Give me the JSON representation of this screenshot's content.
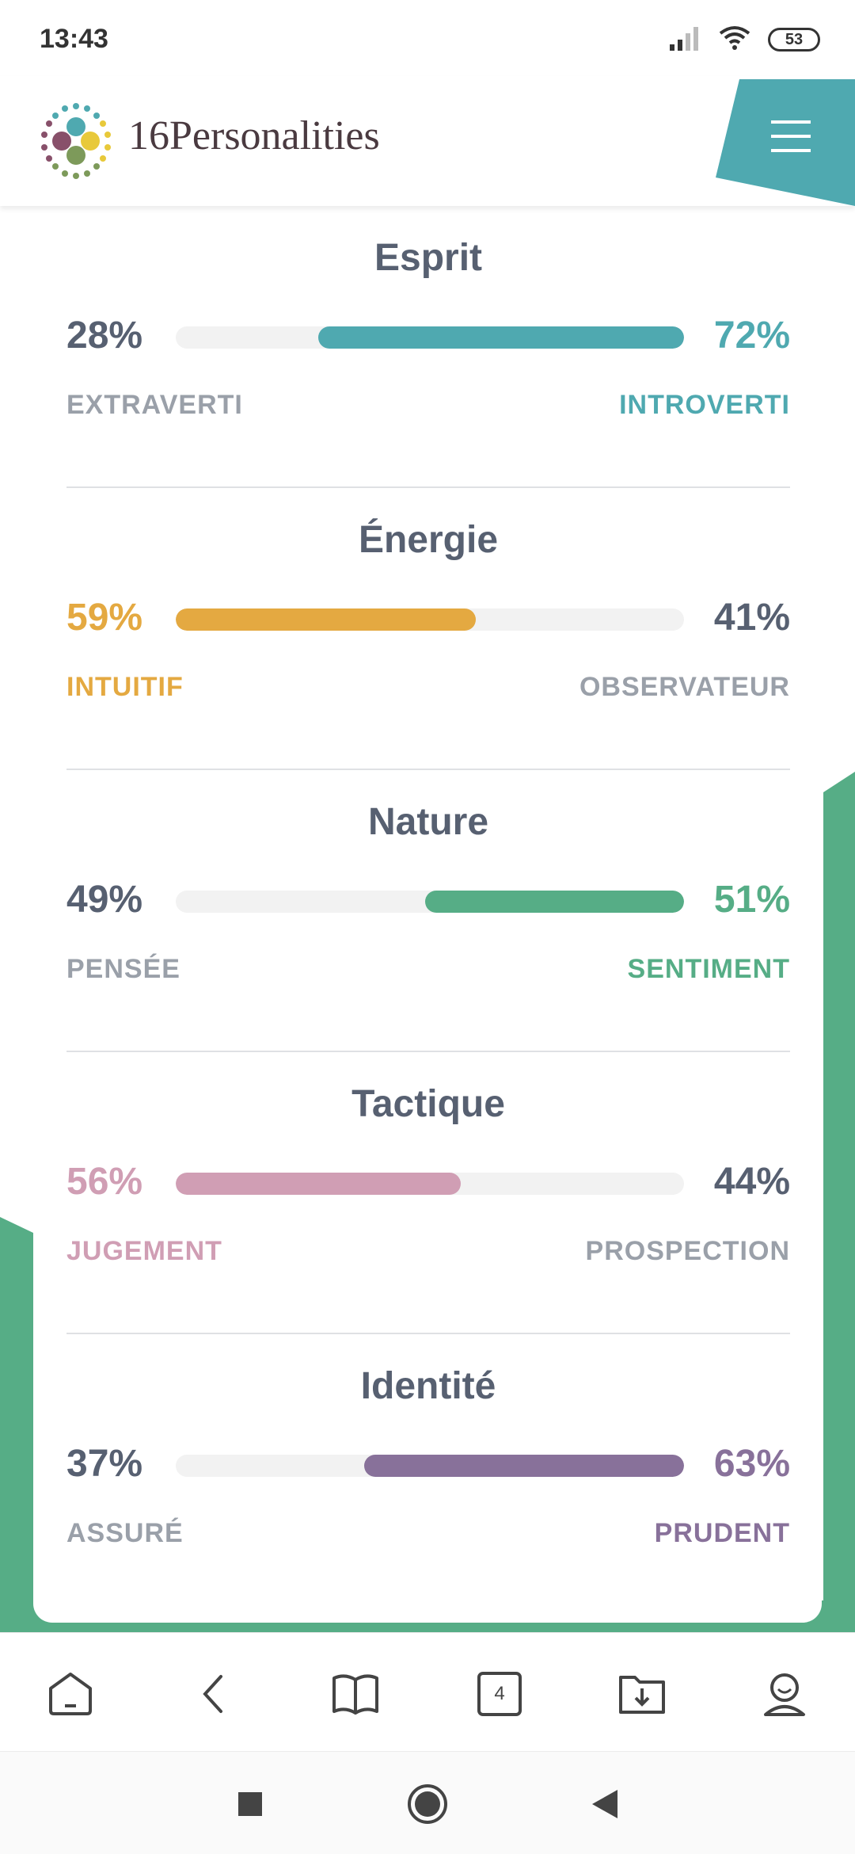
{
  "status_bar": {
    "time": "13:43",
    "battery": "53"
  },
  "header": {
    "logo_text": "16Personalities"
  },
  "traits": [
    {
      "title": "Esprit",
      "left_pct": "28%",
      "right_pct": "72%",
      "left_label": "EXTRAVERTI",
      "right_label": "INTROVERTI",
      "dominant": "right",
      "fill_fraction": 0.72,
      "color": "#4fa9b0"
    },
    {
      "title": "Énergie",
      "left_pct": "59%",
      "right_pct": "41%",
      "left_label": "INTUITIF",
      "right_label": "OBSERVATEUR",
      "dominant": "left",
      "fill_fraction": 0.59,
      "color": "#e4a941"
    },
    {
      "title": "Nature",
      "left_pct": "49%",
      "right_pct": "51%",
      "left_label": "PENSÉE",
      "right_label": "SENTIMENT",
      "dominant": "right",
      "fill_fraction": 0.51,
      "color": "#56ad86"
    },
    {
      "title": "Tactique",
      "left_pct": "56%",
      "right_pct": "44%",
      "left_label": "JUGEMENT",
      "right_label": "PROSPECTION",
      "dominant": "left",
      "fill_fraction": 0.56,
      "color": "#d09eb4"
    },
    {
      "title": "Identité",
      "left_pct": "37%",
      "right_pct": "63%",
      "left_label": "ASSURÉ",
      "right_label": "PRUDENT",
      "dominant": "right",
      "fill_fraction": 0.63,
      "color": "#88719a"
    }
  ],
  "colors": {
    "neutral_text": "#576071",
    "label_gray": "#9aa0a9",
    "background_green": "#56ad86",
    "menu_teal": "#4fa9b0"
  },
  "toolbar": {
    "tabs_count": "4"
  },
  "icons": {
    "toolbar": [
      "home-icon",
      "back-icon",
      "reading-mode-icon",
      "tabs-icon",
      "downloads-icon",
      "profile-icon"
    ],
    "navbar": [
      "recents-icon",
      "home-circle-icon",
      "back-triangle-icon"
    ]
  }
}
